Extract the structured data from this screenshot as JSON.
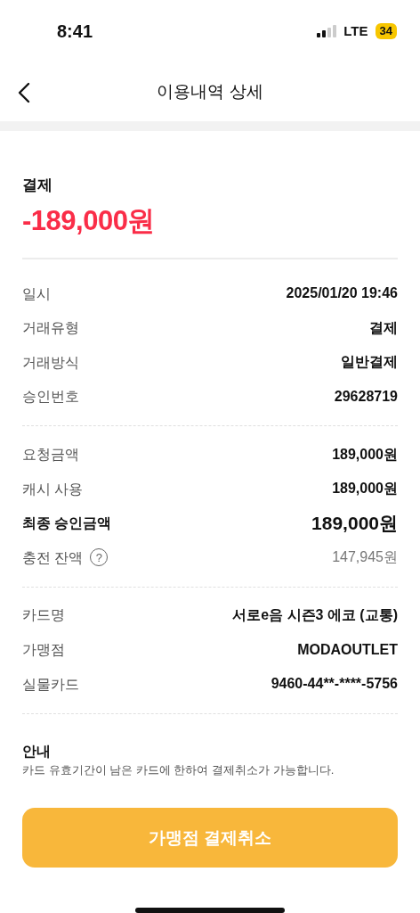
{
  "status_bar": {
    "time": "8:41",
    "network": "LTE",
    "battery": "34"
  },
  "header": {
    "title": "이용내역 상세"
  },
  "summary": {
    "type_label": "결제",
    "amount": "-189,000원"
  },
  "sections": [
    {
      "rows": [
        {
          "kind": "normal",
          "label": "일시",
          "value": "2025/01/20 19:46"
        },
        {
          "kind": "normal",
          "label": "거래유형",
          "value": "결제"
        },
        {
          "kind": "normal",
          "label": "거래방식",
          "value": "일반결제"
        },
        {
          "kind": "normal",
          "label": "승인번호",
          "value": "29628719"
        }
      ]
    },
    {
      "rows": [
        {
          "kind": "normal",
          "label": "요청금액",
          "value": "189,000원"
        },
        {
          "kind": "normal",
          "label": "캐시 사용",
          "value": "189,000원"
        },
        {
          "kind": "total",
          "label": "최종 승인금액",
          "value": "189,000원"
        },
        {
          "kind": "help",
          "label": "충전 잔액",
          "value": "147,945원",
          "help_icon": "?"
        }
      ]
    },
    {
      "rows": [
        {
          "kind": "normal",
          "label": "카드명",
          "value": "서로e음 시즌3 에코 (교통)"
        },
        {
          "kind": "normal",
          "label": "가맹점",
          "value": "MODAOUTLET"
        },
        {
          "kind": "normal",
          "label": "실물카드",
          "value": "9460-44**-****-5756"
        }
      ]
    }
  ],
  "notice": {
    "title": "안내",
    "text": "카드 유효기간이 남은 카드에 한하여 결제취소가 가능합니다."
  },
  "button": {
    "label": "가맹점 결제취소"
  }
}
